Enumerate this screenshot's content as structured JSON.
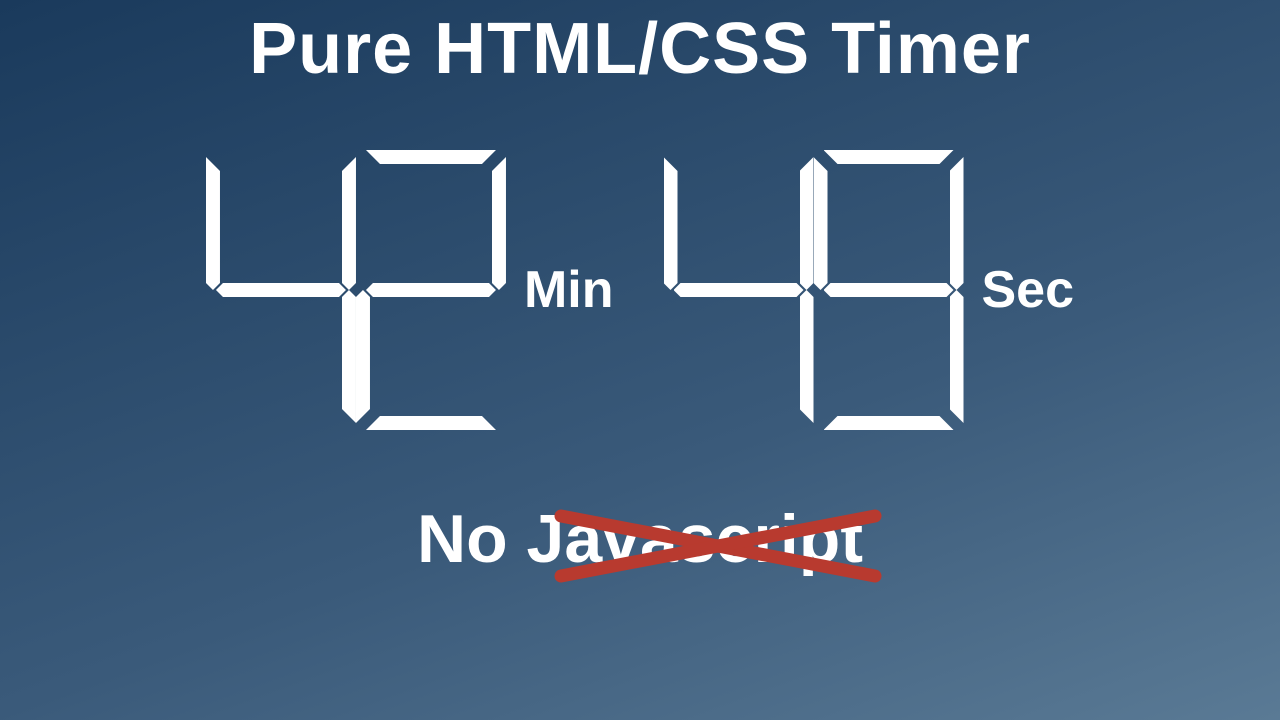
{
  "title": "Pure HTML/CSS Timer",
  "timer": {
    "minutes": {
      "tens": 4,
      "ones": 2,
      "label": "Min"
    },
    "seconds": {
      "tens": 4,
      "ones": 9,
      "label": "Sec"
    }
  },
  "bottom_text": "No Javascript",
  "colors": {
    "strike": "#b83a2f",
    "foreground": "#ffffff"
  }
}
